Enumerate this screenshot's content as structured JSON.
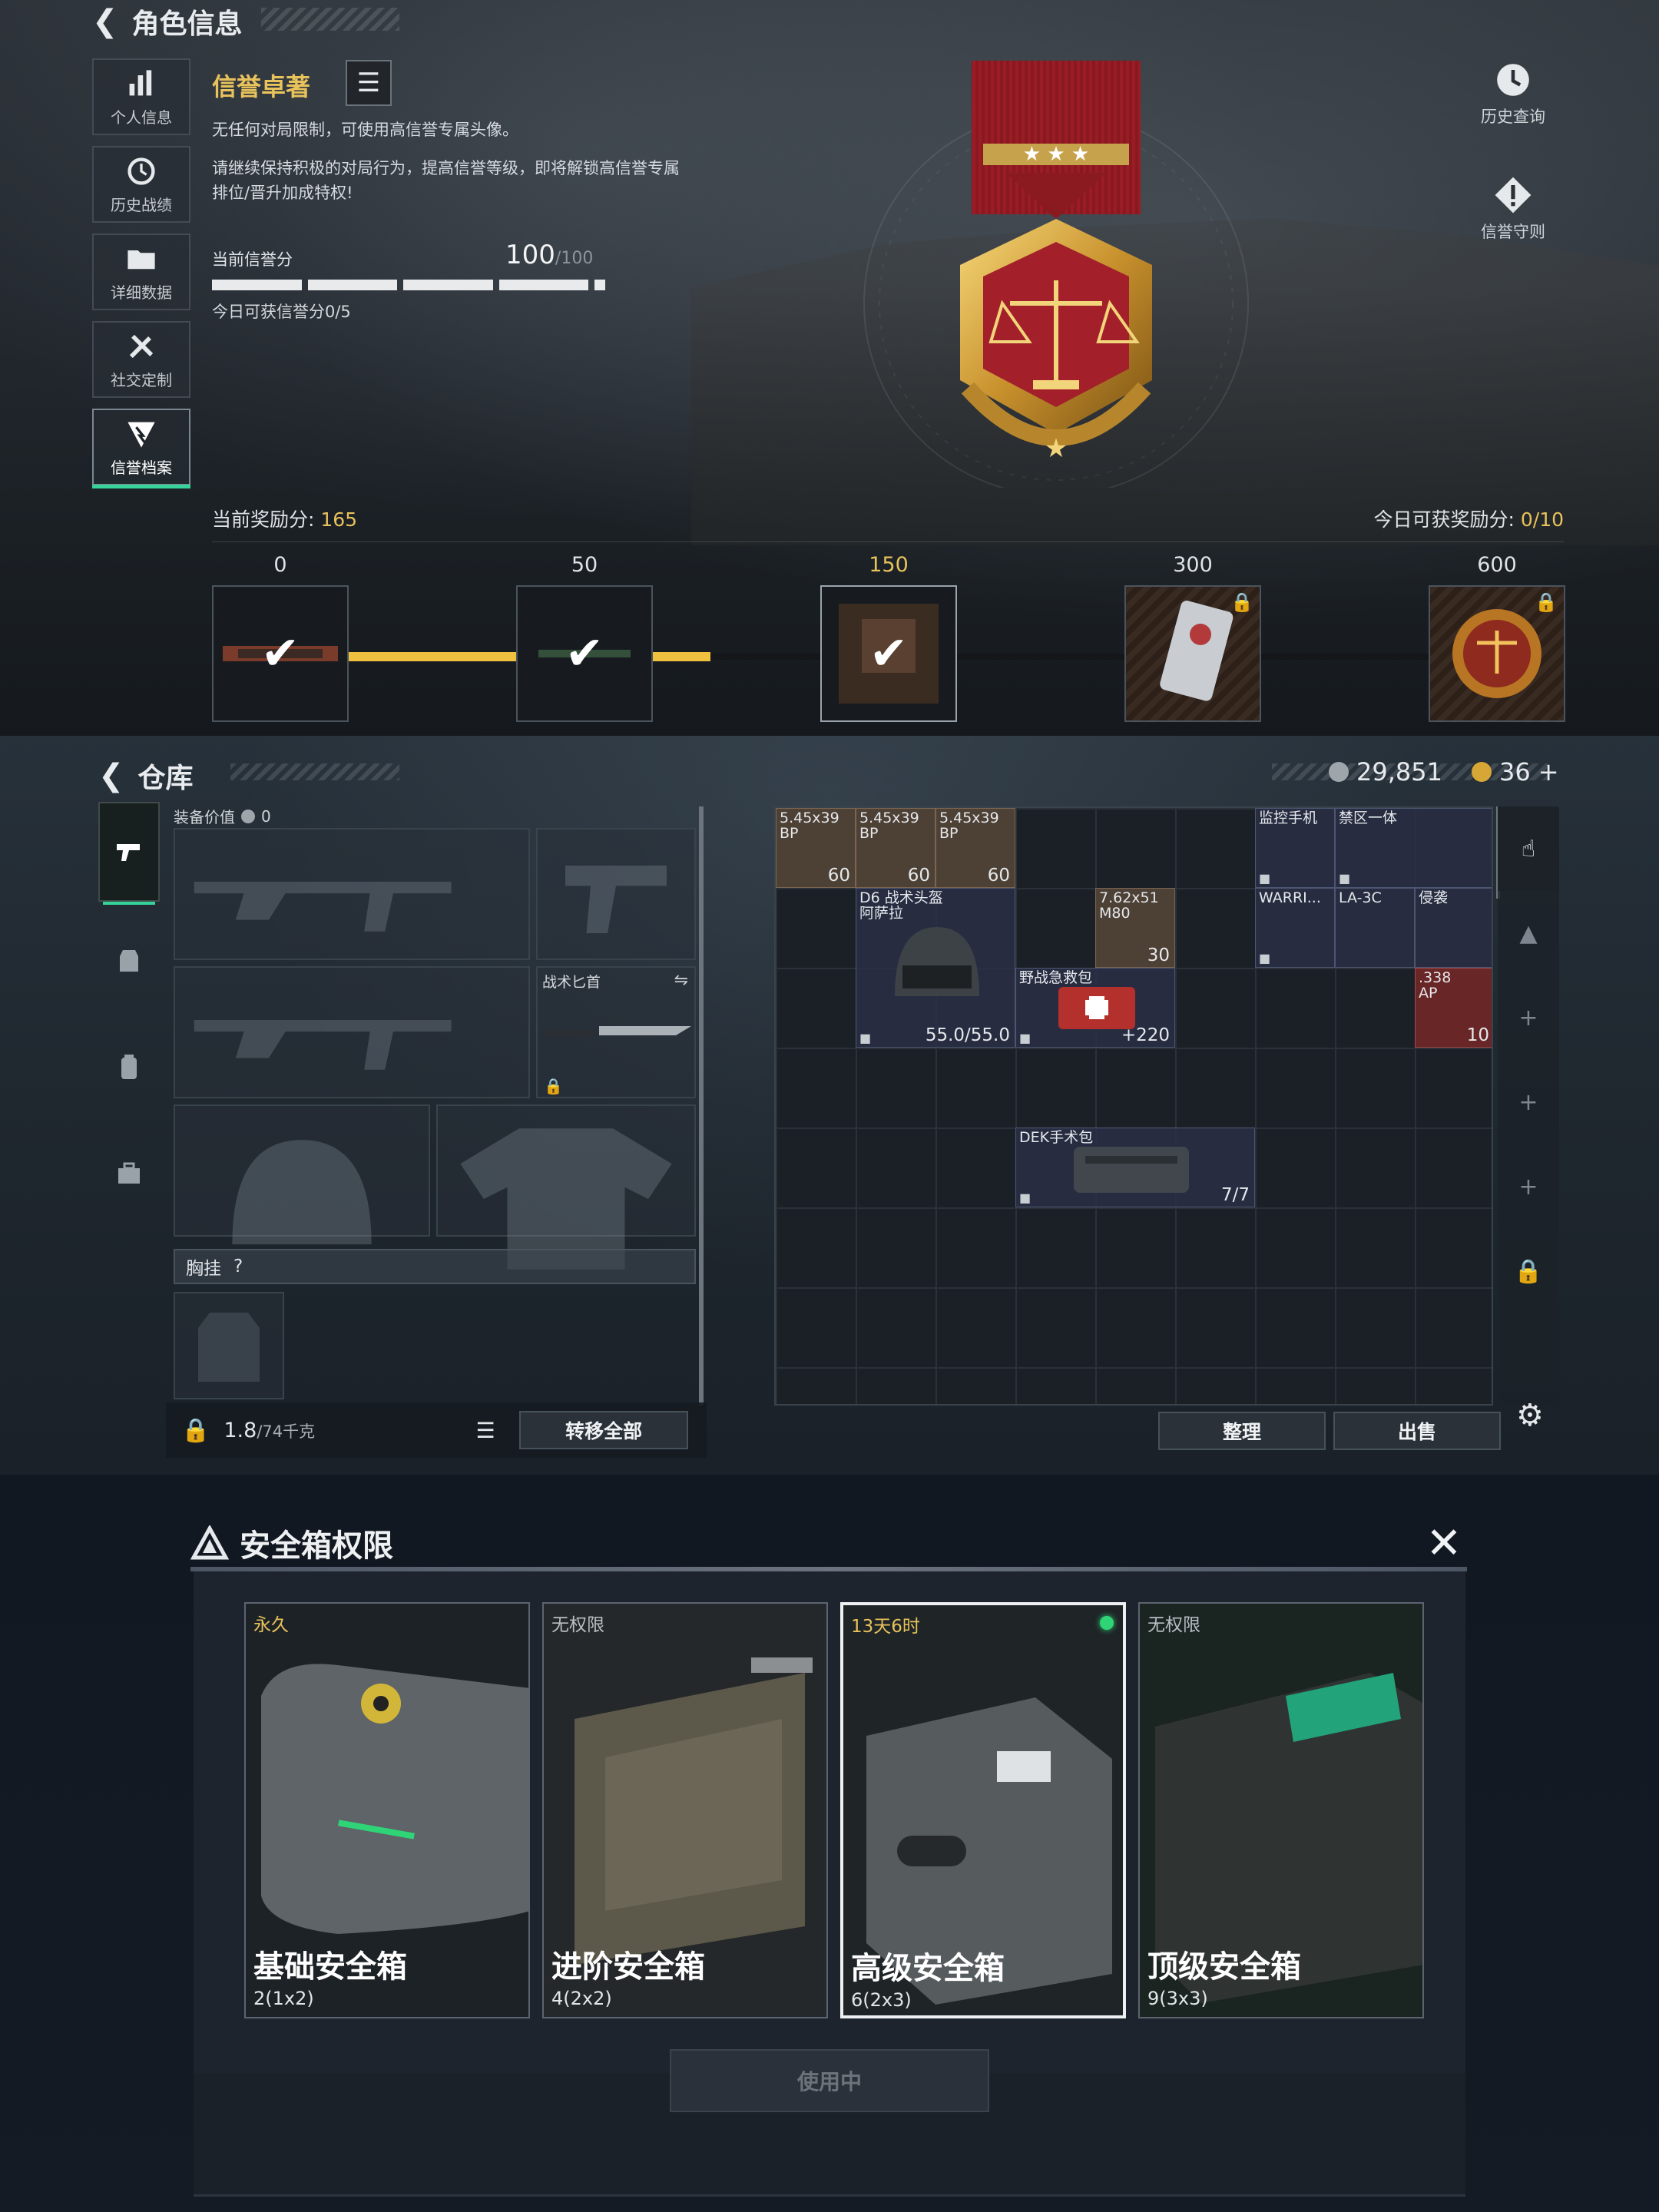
{
  "character": {
    "header": {
      "title": "角色信息",
      "back_icon": "back-arrow-icon"
    },
    "side_nav": [
      {
        "label": "个人信息",
        "icon": "bar-chart-icon",
        "active": false
      },
      {
        "label": "历史战绩",
        "icon": "history-icon",
        "active": false
      },
      {
        "label": "详细数据",
        "icon": "folder-icon",
        "active": false
      },
      {
        "label": "社交定制",
        "icon": "tools-icon",
        "active": false
      },
      {
        "label": "信誉档案",
        "icon": "shield-emblem-icon",
        "active": true
      }
    ],
    "reputation": {
      "title": "信誉卓著",
      "desc1": "无任何对局限制，可使用高信誉专属头像。",
      "desc2": "请继续保持积极的对局行为，提高信誉等级，即将解锁高信誉专属",
      "desc3": "排位/晋升加成特权!",
      "credit_label": "当前信誉分",
      "credit_value": "100",
      "credit_max": "/100",
      "daily_credit": "今日可获信誉分0/5"
    },
    "right_buttons": {
      "history": "历史查询",
      "rules": "信誉守则"
    },
    "rewards": {
      "current_label": "当前奖励分: ",
      "current_value": "165",
      "today_label": "今日可获奖励分: ",
      "today_value": "0/10",
      "progress_fraction": 0.345,
      "milestones": [
        {
          "value": "0",
          "state": "claimed"
        },
        {
          "value": "50",
          "state": "claimed"
        },
        {
          "value": "150",
          "state": "claimed"
        },
        {
          "value": "300",
          "state": "locked"
        },
        {
          "value": "600",
          "state": "locked"
        }
      ]
    }
  },
  "warehouse": {
    "header": {
      "title": "仓库"
    },
    "currency": {
      "silver": "29,851",
      "gold": "36",
      "gold_plus": "+"
    },
    "equip_value_label": "装备价值",
    "equip_value": "0",
    "knife_label": "战术匕首",
    "chest_label": "胸挂",
    "chest_help": "?",
    "weight": "1.8",
    "weight_max": "/74千克",
    "transfer_all": "转移全部",
    "sort": "整理",
    "sell": "出售",
    "items": [
      {
        "name": "5.45x39\nBP",
        "qty": "60",
        "kind": "ammo"
      },
      {
        "name": "5.45x39\nBP",
        "qty": "60",
        "kind": "ammo"
      },
      {
        "name": "5.45x39\nBP",
        "qty": "60",
        "kind": "ammo"
      },
      {
        "name": "监控手机",
        "qty": "",
        "kind": "normal"
      },
      {
        "name": "禁区一体",
        "qty": "",
        "kind": "normal"
      },
      {
        "name": "D6 战术头盔\n阿萨拉",
        "qty": "55.0/55.0",
        "kind": "normal"
      },
      {
        "name": "7.62x51\nM80",
        "qty": "30",
        "kind": "ammo"
      },
      {
        "name": "WARRI...",
        "qty": "",
        "kind": "normal"
      },
      {
        "name": "LA-3C",
        "qty": "",
        "kind": "normal"
      },
      {
        "name": "侵袭",
        "qty": "",
        "kind": "normal"
      },
      {
        "name": "野战急救包",
        "qty": "+220",
        "kind": "normal"
      },
      {
        "name": ".338\nAP",
        "qty": "10",
        "kind": "red"
      },
      {
        "name": "DEK手术包",
        "qty": "7/7",
        "kind": "normal"
      }
    ]
  },
  "safebox": {
    "title": "安全箱权限",
    "use_button": "使用中",
    "cards": [
      {
        "tag": "永久",
        "name": "基础安全箱",
        "capacity": "2(1x2)",
        "selected": false,
        "tag_gold": true
      },
      {
        "tag": "无权限",
        "name": "进阶安全箱",
        "capacity": "4(2x2)",
        "selected": false,
        "tag_gold": false
      },
      {
        "tag": "13天6时",
        "name": "高级安全箱",
        "capacity": "6(2x3)",
        "selected": true,
        "tag_gold": true
      },
      {
        "tag": "无权限",
        "name": "顶级安全箱",
        "capacity": "9(3x3)",
        "selected": false,
        "tag_gold": false
      }
    ]
  }
}
